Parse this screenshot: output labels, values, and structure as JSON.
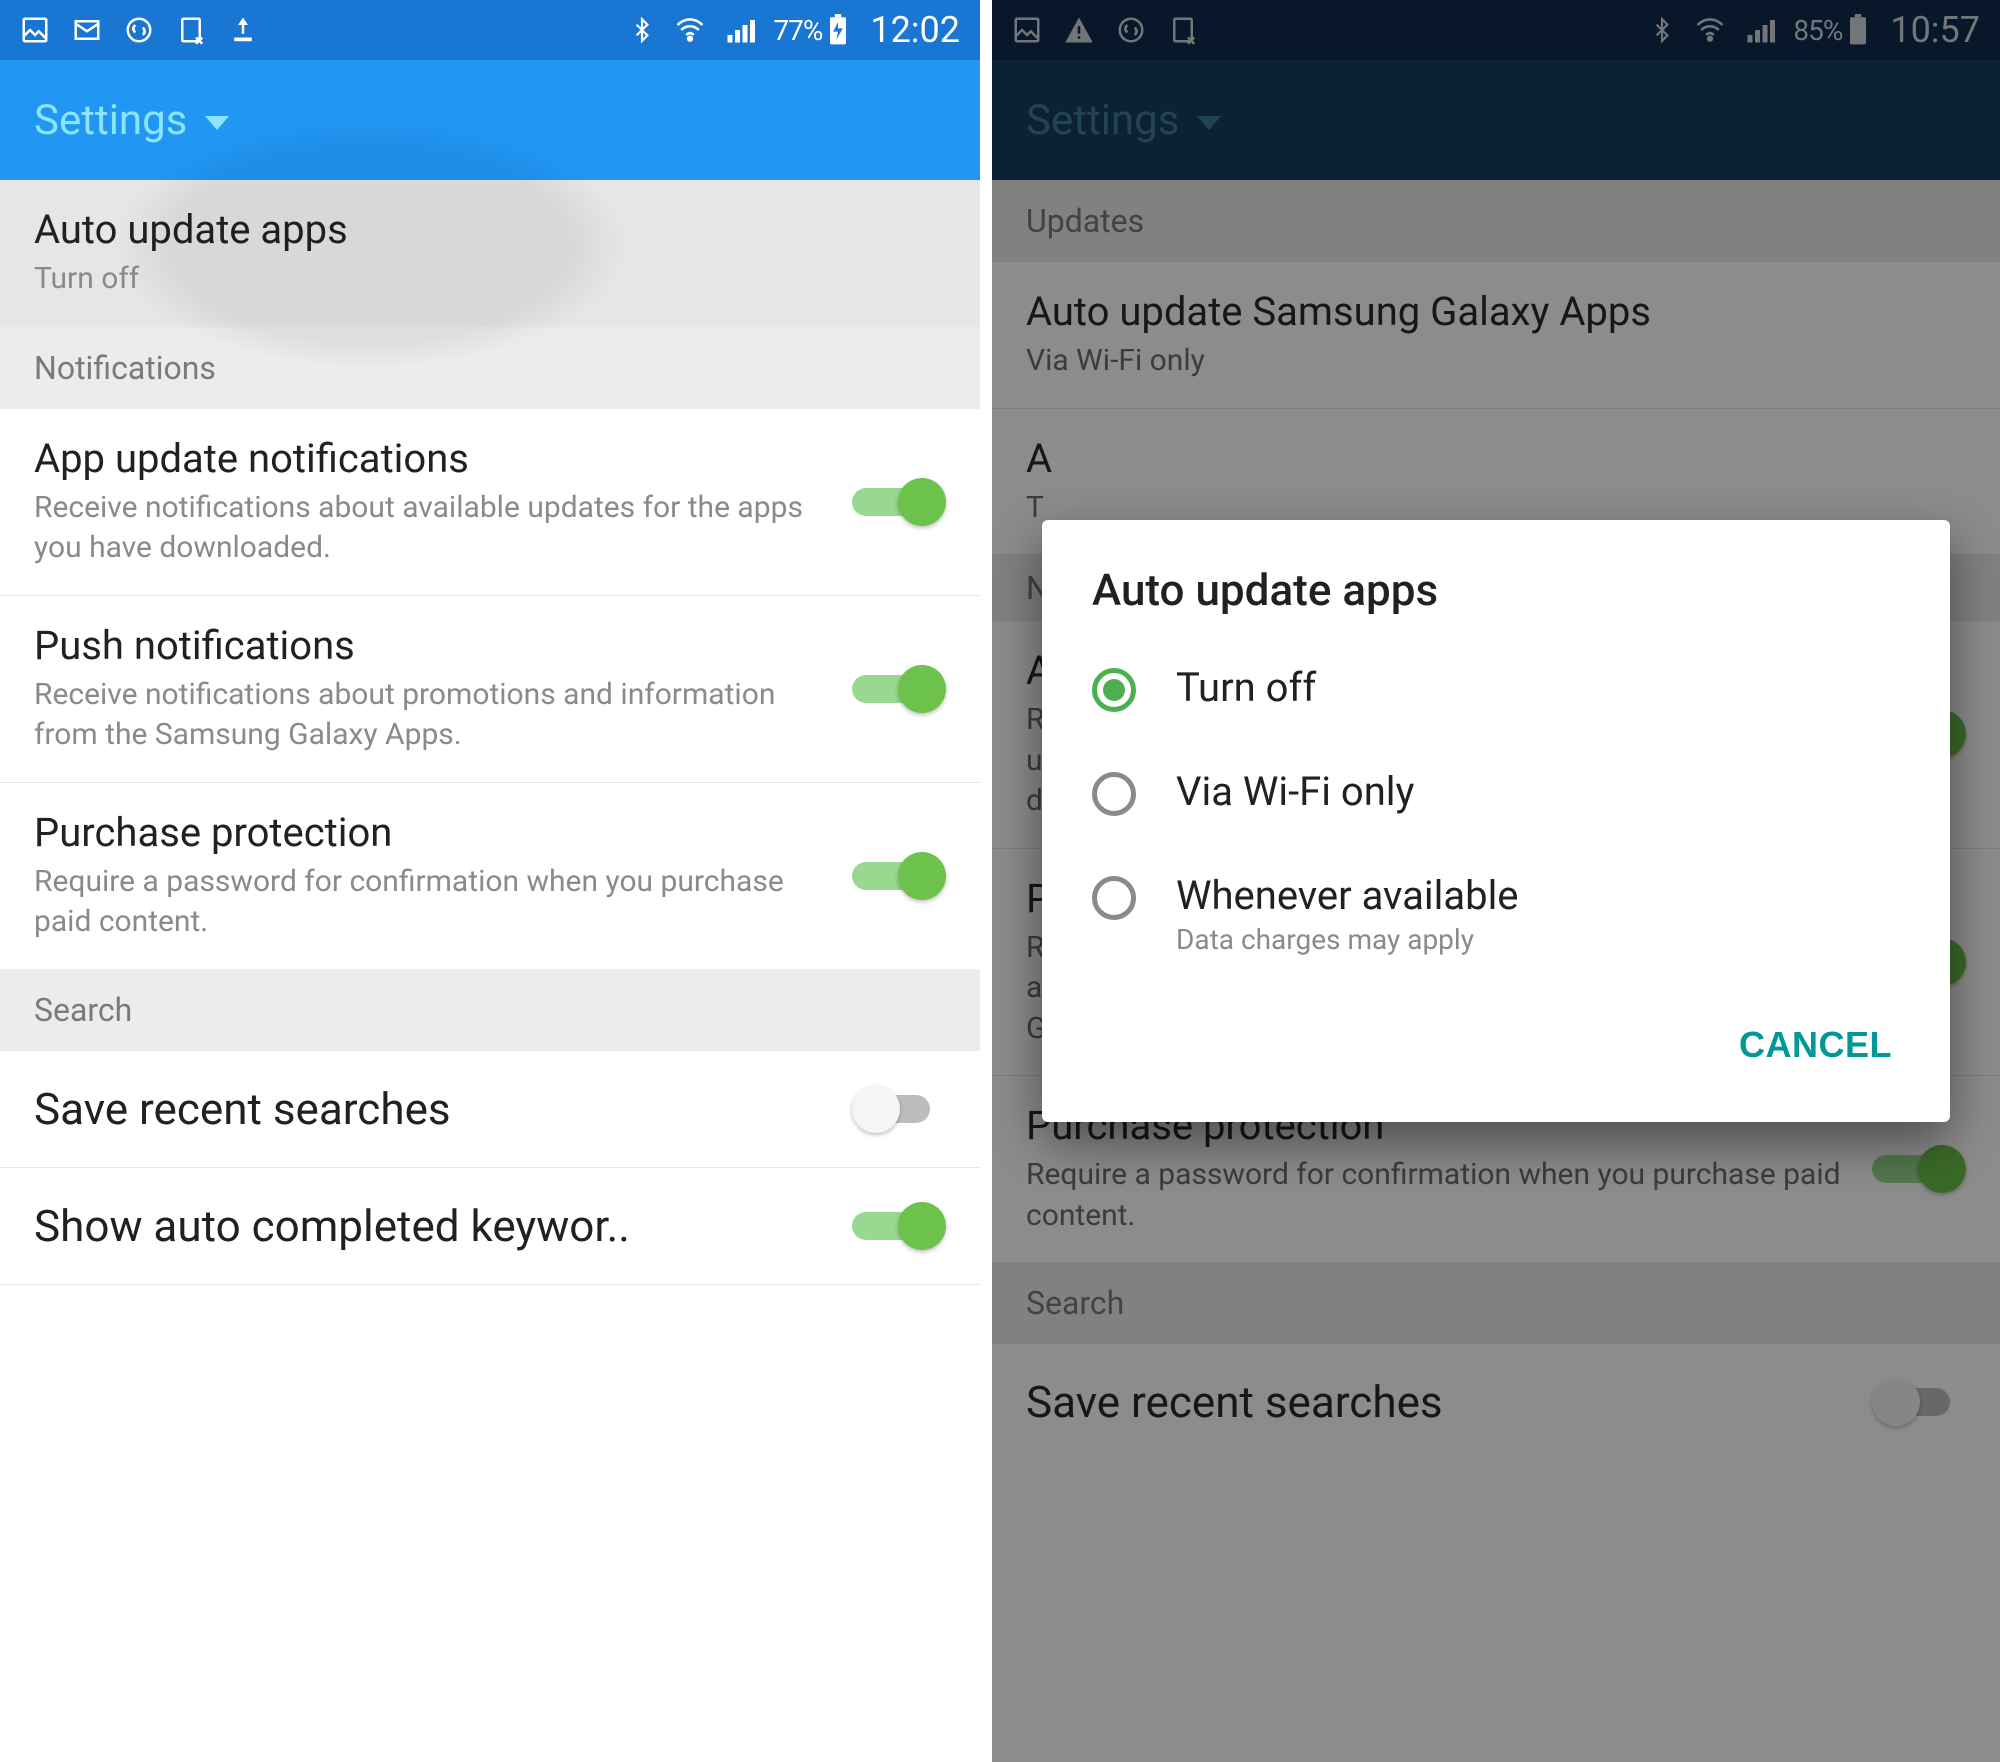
{
  "left": {
    "status": {
      "battery": "77%",
      "time": "12:02"
    },
    "appbar": {
      "title": "Settings"
    },
    "auto_update": {
      "title": "Auto update apps",
      "sub": "Turn off"
    },
    "sections": {
      "notifications": "Notifications",
      "search": "Search"
    },
    "items": {
      "app_update_notif": {
        "title": "App update notifications",
        "sub": "Receive notifications about available updates for the apps you have downloaded."
      },
      "push_notif": {
        "title": "Push notifications",
        "sub": "Receive notifications about promotions and information from the Samsung Galaxy Apps."
      },
      "purchase_protection": {
        "title": "Purchase protection",
        "sub": "Require a password for confirmation when you purchase paid content."
      },
      "save_recent": {
        "title": "Save recent searches"
      },
      "auto_complete": {
        "title": "Show auto completed keywor.."
      }
    }
  },
  "right": {
    "status": {
      "battery": "85%",
      "time": "10:57"
    },
    "appbar": {
      "title": "Settings"
    },
    "sections": {
      "updates": "Updates",
      "notifications": "N",
      "search": "Search"
    },
    "bg": {
      "auto_update_galaxy": {
        "title": "Auto update Samsung Galaxy Apps",
        "sub": "Via Wi-Fi only"
      },
      "auto_truncated": {
        "title": "A",
        "sub": "T"
      },
      "app_update_notif": {
        "title": "A",
        "sub1": "R",
        "sub2": "u",
        "sub3": "d"
      },
      "push": {
        "title": "P",
        "sub1": "R",
        "sub2": "a",
        "sub3": "G"
      },
      "purchase_protection": {
        "title": "Purchase protection",
        "sub": "Require a password for confirmation when you purchase paid content."
      },
      "save_recent": {
        "title": "Save recent searches"
      }
    },
    "dialog": {
      "title": "Auto update apps",
      "options": [
        {
          "label": "Turn off",
          "sub": "",
          "selected": true
        },
        {
          "label": "Via Wi-Fi only",
          "sub": "",
          "selected": false
        },
        {
          "label": "Whenever available",
          "sub": "Data charges may apply",
          "selected": false
        }
      ],
      "cancel": "CANCEL"
    }
  }
}
